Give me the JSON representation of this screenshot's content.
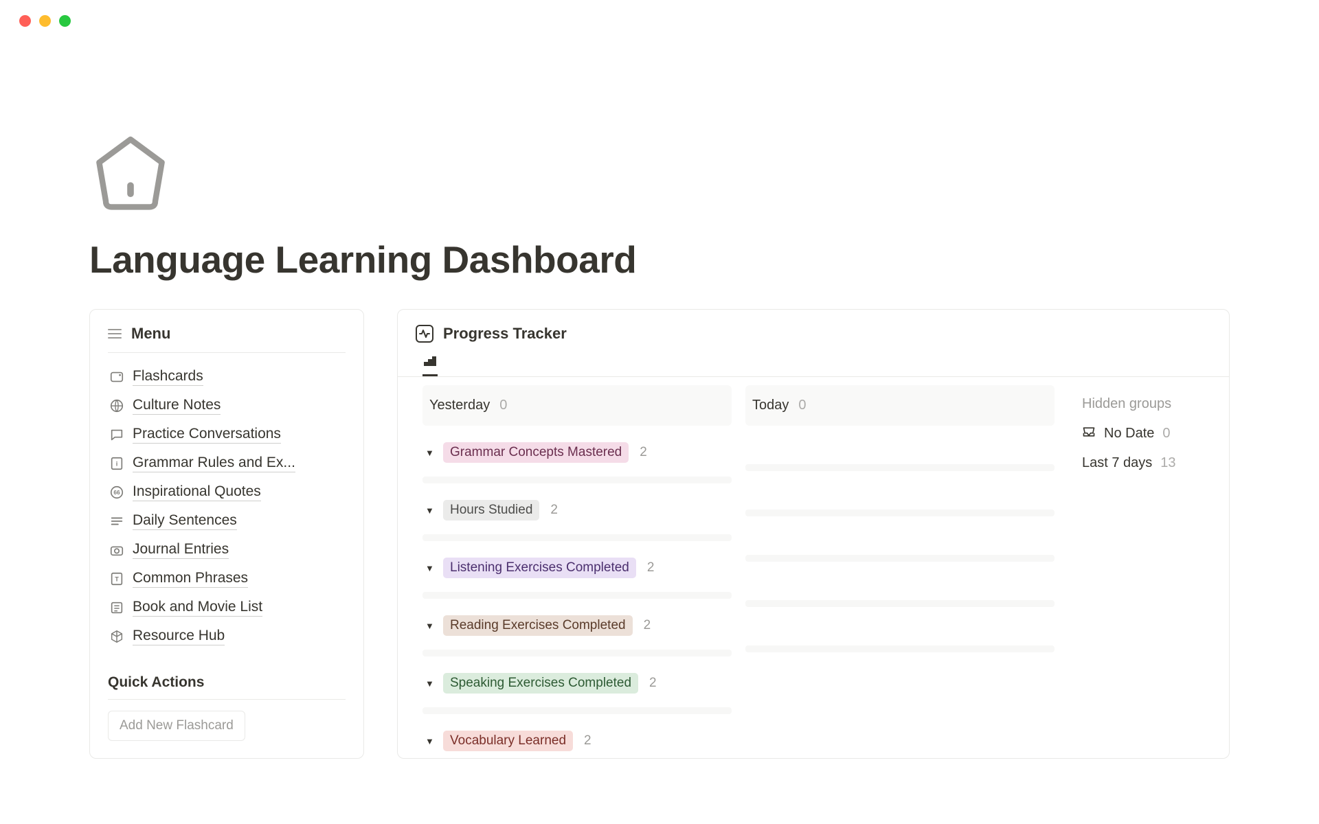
{
  "title": "Language Learning Dashboard",
  "sidebar": {
    "menu_label": "Menu",
    "items": [
      {
        "label": "Flashcards",
        "icon": "card"
      },
      {
        "label": "Culture Notes",
        "icon": "globe"
      },
      {
        "label": "Practice Conversations",
        "icon": "chat"
      },
      {
        "label": "Grammar Rules and Ex...",
        "icon": "doc-i"
      },
      {
        "label": "Inspirational Quotes",
        "icon": "quote"
      },
      {
        "label": "Daily Sentences",
        "icon": "lines"
      },
      {
        "label": "Journal Entries",
        "icon": "camera"
      },
      {
        "label": "Common Phrases",
        "icon": "doc-t"
      },
      {
        "label": "Book and Movie List",
        "icon": "list"
      },
      {
        "label": "Resource Hub",
        "icon": "cube"
      }
    ],
    "quick_actions_label": "Quick Actions",
    "add_flashcard_label": "Add New Flashcard"
  },
  "progress_tracker": {
    "title": "Progress Tracker",
    "columns": {
      "yesterday": {
        "label": "Yesterday",
        "count": "0"
      },
      "today": {
        "label": "Today",
        "count": "0"
      }
    },
    "hidden_groups_label": "Hidden groups",
    "hidden": [
      {
        "label": "No Date",
        "count": "0",
        "icon": "inbox"
      },
      {
        "label": "Last 7 days",
        "count": "13",
        "icon": null
      }
    ],
    "groups": [
      {
        "label": "Grammar Concepts Mastered",
        "count": "2",
        "tag": "pink"
      },
      {
        "label": "Hours Studied",
        "count": "2",
        "tag": "gray"
      },
      {
        "label": "Listening Exercises Completed",
        "count": "2",
        "tag": "purple"
      },
      {
        "label": "Reading Exercises Completed",
        "count": "2",
        "tag": "brown"
      },
      {
        "label": "Speaking Exercises Completed",
        "count": "2",
        "tag": "green"
      },
      {
        "label": "Vocabulary Learned",
        "count": "2",
        "tag": "red"
      }
    ]
  }
}
